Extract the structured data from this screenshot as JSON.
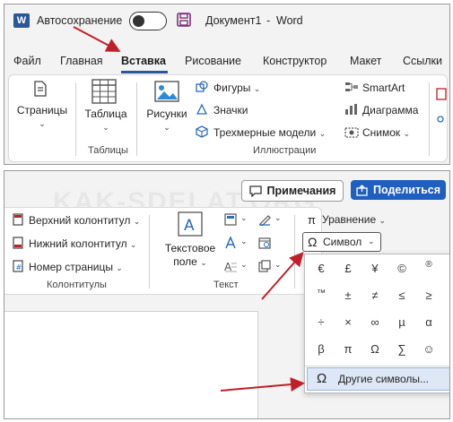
{
  "titlebar": {
    "autosave_label": "Автосохранение",
    "doc_title": "Документ1",
    "separator": "-",
    "app_name": "Word"
  },
  "tabs": [
    "Файл",
    "Главная",
    "Вставка",
    "Рисование",
    "Конструктор",
    "Макет",
    "Ссылки"
  ],
  "ribbon": {
    "pages_label": "Страницы",
    "table_label": "Таблица",
    "tables_group": "Таблицы",
    "pictures_label": "Рисунки",
    "shapes_label": "Фигуры",
    "icons_label": "Значки",
    "models_label": "Трехмерные модели",
    "smartart_label": "SmartArt",
    "chart_label": "Диаграмма",
    "screenshot_label": "Снимок",
    "illustrations_group": "Иллюстрации"
  },
  "panel2": {
    "comments_label": "Примечания",
    "share_label": "Поделиться",
    "header_label": "Верхний колонтитул",
    "footer_label": "Нижний колонтитул",
    "page_number_label": "Номер страницы",
    "headers_group": "Колонтитулы",
    "textbox_line1": "Текстовое",
    "textbox_line2": "поле",
    "text_group": "Текст",
    "equation_label": "Уравнение",
    "symbol_label": "Символ",
    "watermark": "KAK-SDELAT.ORG"
  },
  "symbols": {
    "row1": [
      "€",
      "£",
      "¥",
      "©",
      "®"
    ],
    "row2": [
      "™",
      "±",
      "≠",
      "≤",
      "≥"
    ],
    "row3": [
      "÷",
      "×",
      "∞",
      "µ",
      "α"
    ],
    "row4": [
      "β",
      "π",
      "Ω",
      "∑",
      "☺"
    ],
    "more_label": "Другие символы..."
  },
  "colors": {
    "accent": "#2b579a",
    "share_blue": "#1f5fbf",
    "arrow_red": "#c0202a",
    "autosave_toggle": "#ffffff"
  }
}
